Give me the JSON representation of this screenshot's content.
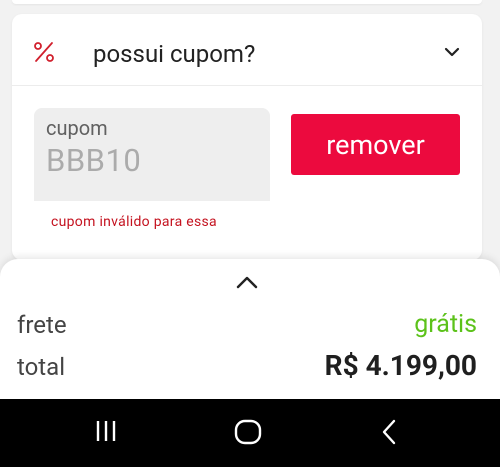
{
  "coupon": {
    "icon": "percent-icon",
    "title": "possui cupom?",
    "expand_icon": "chevron-down-icon",
    "field_label": "cupom",
    "field_value": "BBB10",
    "remove_label": "remover",
    "error_message": "cupom inválido para essa"
  },
  "summary": {
    "toggle_icon": "chevron-up-icon",
    "shipping_label": "frete",
    "shipping_value": "grátis",
    "total_label": "total",
    "total_value": "R$ 4.199,00"
  },
  "nav": {
    "recent_icon": "recent-apps-icon",
    "home_icon": "home-icon",
    "back_icon": "back-icon"
  },
  "colors": {
    "accent": "#ec0a3e",
    "error": "#c4121f",
    "free_shipping": "#5cc21a"
  }
}
